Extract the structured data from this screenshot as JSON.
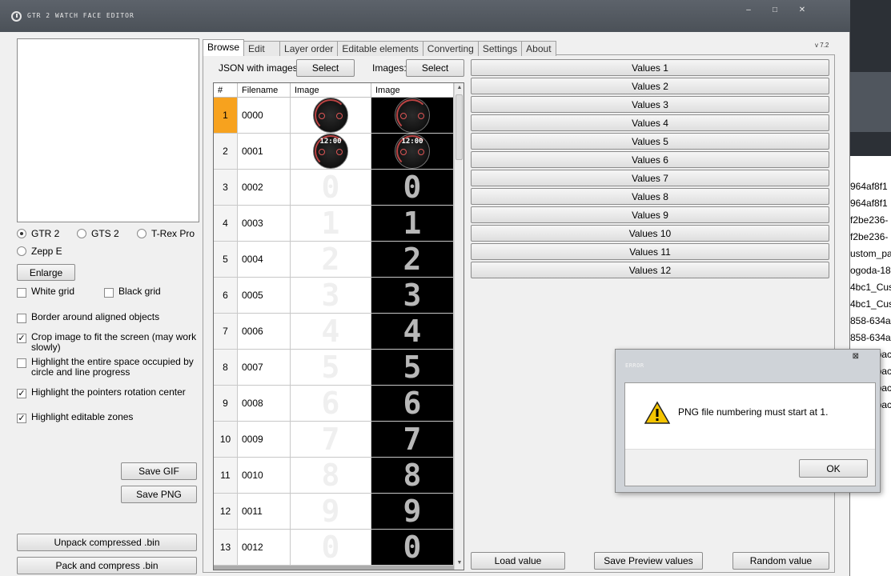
{
  "window": {
    "title": "GTR 2 WATCH FACE EDITOR"
  },
  "window_controls": {
    "minimize": "–",
    "maximize": "□",
    "close": "✕"
  },
  "left_panel": {
    "radios": [
      {
        "label": "GTR 2",
        "checked": true
      },
      {
        "label": "GTS 2",
        "checked": false
      },
      {
        "label": "T-Rex Pro",
        "checked": false
      },
      {
        "label": "Zepp E",
        "checked": false
      }
    ],
    "enlarge_label": "Enlarge",
    "checks": [
      {
        "label": "White grid",
        "checked": false
      },
      {
        "label": "Black grid",
        "checked": false
      },
      {
        "label": "Border around aligned objects",
        "checked": false
      },
      {
        "label": "Crop image to fit the screen (may work slowly)",
        "checked": true
      },
      {
        "label": "Highlight the entire space occupied by circle and line progress",
        "checked": false
      },
      {
        "label": "Highlight the pointers rotation center",
        "checked": true
      },
      {
        "label": "Highlight editable zones",
        "checked": true
      }
    ],
    "save_gif_label": "Save GIF",
    "save_png_label": "Save PNG",
    "unpack_label": "Unpack compressed .bin",
    "pack_label": "Pack and compress .bin"
  },
  "tabs": [
    "Browse",
    "Edit",
    "Layer order",
    "Editable elements",
    "Converting",
    "Settings",
    "About"
  ],
  "version": "v 7.2",
  "browse": {
    "json_label": "JSON with images:",
    "json_select": "Select",
    "images_label": "Images:",
    "images_select": "Select",
    "grid": {
      "headers": [
        "#",
        "Filename",
        "Image",
        "Image"
      ],
      "rows": [
        {
          "num": "1",
          "file": "0000",
          "img": "watch-dial"
        },
        {
          "num": "2",
          "file": "0001",
          "img": "watch-time"
        },
        {
          "num": "3",
          "file": "0002",
          "img": "0"
        },
        {
          "num": "4",
          "file": "0003",
          "img": "1"
        },
        {
          "num": "5",
          "file": "0004",
          "img": "2"
        },
        {
          "num": "6",
          "file": "0005",
          "img": "3"
        },
        {
          "num": "7",
          "file": "0006",
          "img": "4"
        },
        {
          "num": "8",
          "file": "0007",
          "img": "5"
        },
        {
          "num": "9",
          "file": "0008",
          "img": "6"
        },
        {
          "num": "10",
          "file": "0009",
          "img": "7"
        },
        {
          "num": "11",
          "file": "0010",
          "img": "8"
        },
        {
          "num": "12",
          "file": "0011",
          "img": "9"
        },
        {
          "num": "13",
          "file": "0012",
          "img": "0"
        }
      ],
      "selected_row": 0,
      "watch_time": "12:00"
    },
    "values": [
      "Values 1",
      "Values 2",
      "Values 3",
      "Values 4",
      "Values 5",
      "Values 6",
      "Values 7",
      "Values 8",
      "Values 9",
      "Values 10",
      "Values 11",
      "Values 12"
    ],
    "load_value": "Load value",
    "save_preview_values": "Save Preview values",
    "random_value": "Random value"
  },
  "dialog": {
    "title": "ERROR",
    "message": "PNG file numbering must start at 1.",
    "ok_label": "OK",
    "close_glyph": "⊠"
  },
  "background_items": [
    "964af8f1",
    "964af8f1",
    "f2be236-",
    "f2be236-",
    "ustom_pa",
    "ogoda-18",
    "4bc1_Cus",
    "4bc1_Cus",
    "858-634a",
    "858-634a",
    "stom_pac",
    "stom_pac",
    "stom_pac",
    "stom_pac"
  ],
  "colors": {
    "selected_row": "#f7a21e",
    "titlebar": "#545a61"
  }
}
